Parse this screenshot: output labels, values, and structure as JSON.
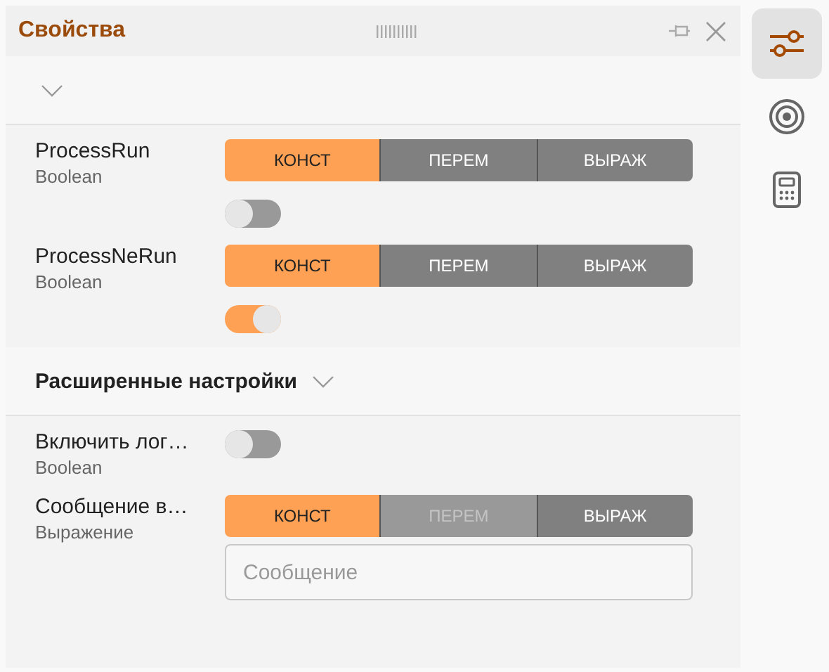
{
  "panel": {
    "title": "Свойства"
  },
  "sections": [
    {
      "expanded": true,
      "properties": [
        {
          "name": "ProcessRun",
          "type": "Boolean",
          "modes": [
            {
              "label": "КОНСТ",
              "selected": true,
              "disabled": false
            },
            {
              "label": "ПЕРЕМ",
              "selected": false,
              "disabled": false
            },
            {
              "label": "ВЫРАЖ",
              "selected": false,
              "disabled": false
            }
          ],
          "switch": {
            "on": false
          }
        },
        {
          "name": "ProcessNeRun",
          "type": "Boolean",
          "modes": [
            {
              "label": "КОНСТ",
              "selected": true,
              "disabled": false
            },
            {
              "label": "ПЕРЕМ",
              "selected": false,
              "disabled": false
            },
            {
              "label": "ВЫРАЖ",
              "selected": false,
              "disabled": false
            }
          ],
          "switch": {
            "on": true
          }
        }
      ]
    },
    {
      "title": "Расширенные настройки",
      "expanded": true,
      "properties": [
        {
          "name": "Включить лог…",
          "type": "Boolean",
          "switch": {
            "on": false
          }
        },
        {
          "name": "Сообщение в…",
          "type": "Выражение",
          "modes": [
            {
              "label": "КОНСТ",
              "selected": true,
              "disabled": false
            },
            {
              "label": "ПЕРЕМ",
              "selected": false,
              "disabled": true
            },
            {
              "label": "ВЫРАЖ",
              "selected": false,
              "disabled": false
            }
          ],
          "input": {
            "placeholder": "Сообщение"
          }
        }
      ]
    }
  ],
  "sidebar": [
    {
      "kind": "sliders",
      "selected": true
    },
    {
      "kind": "target",
      "selected": false
    },
    {
      "kind": "calculator",
      "selected": false
    }
  ]
}
